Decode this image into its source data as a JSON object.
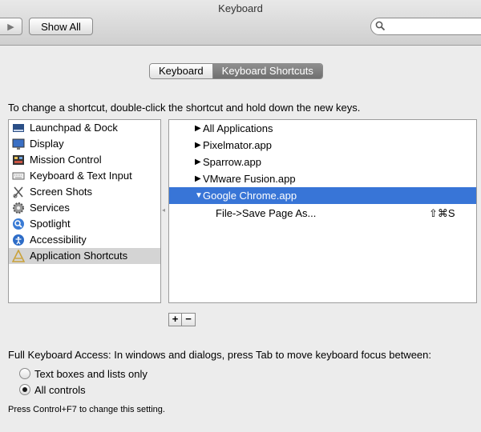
{
  "window": {
    "title": "Keyboard"
  },
  "toolbar": {
    "nav_arrow": "▶",
    "show_all_label": "Show All",
    "search_placeholder": "",
    "search_icon": "search-icon"
  },
  "tabs": [
    {
      "label": "Keyboard",
      "selected": false
    },
    {
      "label": "Keyboard Shortcuts",
      "selected": true
    }
  ],
  "instructions": "To change a shortcut, double-click the shortcut and hold down the new keys.",
  "categories": [
    {
      "label": "Launchpad & Dock",
      "icon": "launchpad-dock-icon",
      "selected": false
    },
    {
      "label": "Display",
      "icon": "display-icon",
      "selected": false
    },
    {
      "label": "Mission Control",
      "icon": "mission-control-icon",
      "selected": false
    },
    {
      "label": "Keyboard & Text Input",
      "icon": "keyboard-icon",
      "selected": false
    },
    {
      "label": "Screen Shots",
      "icon": "screen-shots-icon",
      "selected": false
    },
    {
      "label": "Services",
      "icon": "services-gear-icon",
      "selected": false
    },
    {
      "label": "Spotlight",
      "icon": "spotlight-icon",
      "selected": false
    },
    {
      "label": "Accessibility",
      "icon": "accessibility-icon",
      "selected": false
    },
    {
      "label": "Application Shortcuts",
      "icon": "application-shortcuts-icon",
      "selected": true
    }
  ],
  "apps": [
    {
      "label": "All Applications",
      "expanded": false,
      "selected": false,
      "triangle": "▶"
    },
    {
      "label": "Pixelmator.app",
      "expanded": false,
      "selected": false,
      "triangle": "▶"
    },
    {
      "label": "Sparrow.app",
      "expanded": false,
      "selected": false,
      "triangle": "▶"
    },
    {
      "label": "VMware Fusion.app",
      "expanded": false,
      "selected": false,
      "triangle": "▶"
    },
    {
      "label": "Google Chrome.app",
      "expanded": true,
      "selected": true,
      "triangle": "▼"
    }
  ],
  "shortcuts": [
    {
      "name": "File->Save Page As...",
      "keys": "⇧⌘S"
    }
  ],
  "controls": {
    "add_label": "+",
    "remove_label": "−",
    "grip": "◂"
  },
  "full_keyboard_access": {
    "label": "Full Keyboard Access: In windows and dialogs, press Tab to move keyboard focus between:",
    "options": [
      {
        "label": "Text boxes and lists only",
        "selected": false
      },
      {
        "label": "All controls",
        "selected": true
      }
    ],
    "hint": "Press Control+F7 to change this setting."
  },
  "colors": {
    "selection_blue": "#3875d7",
    "selection_gray": "#d4d4d4",
    "segment_active": "#7a7a7a"
  }
}
